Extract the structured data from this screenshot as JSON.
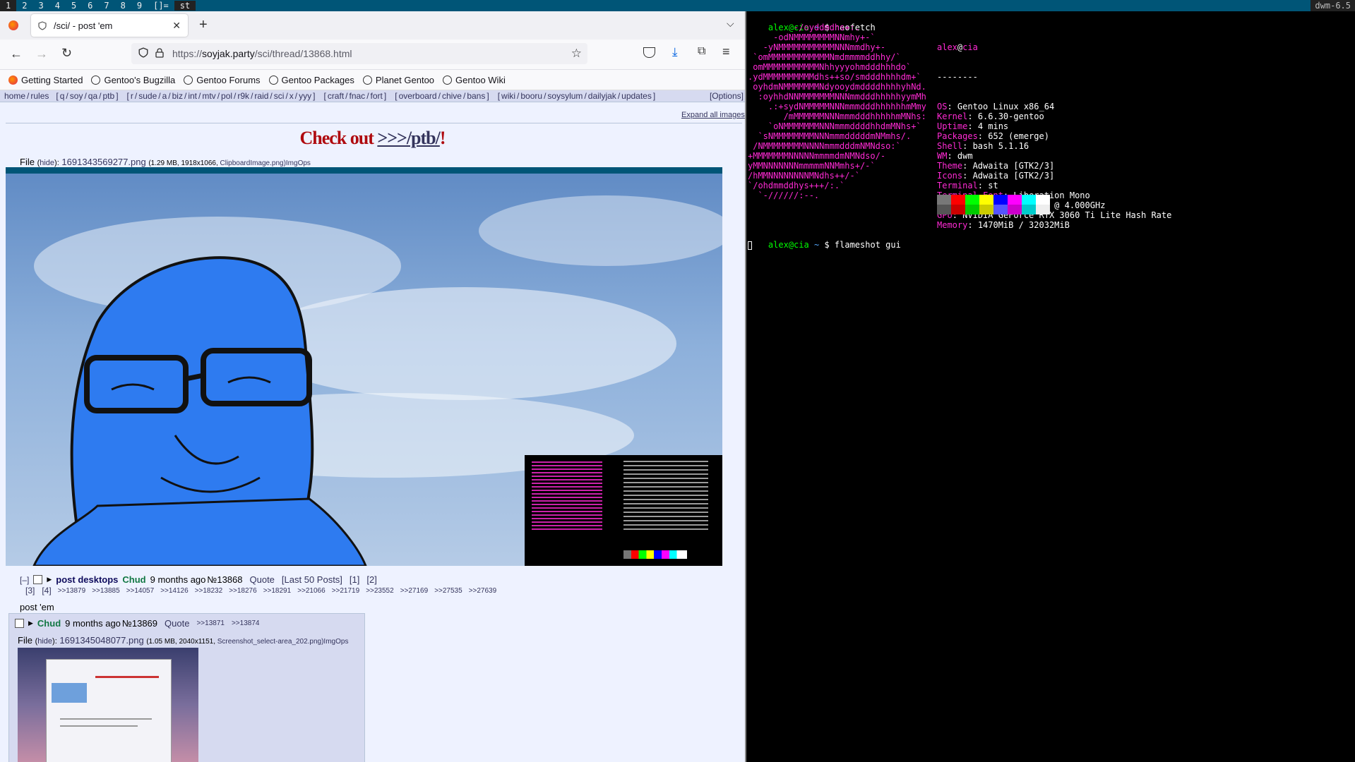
{
  "dwm": {
    "tags": [
      "1",
      "2",
      "3",
      "4",
      "5",
      "6",
      "7",
      "8",
      "9"
    ],
    "layout": "[]=",
    "window_title": "st",
    "status": "dwm-6.5"
  },
  "firefox": {
    "tab_title": "/sci/ - post 'em",
    "url_prefix": "https://",
    "url_domain": "soyjak.party",
    "url_path": "/sci/thread/13868.html",
    "bookmarks": [
      "Getting Started",
      "Gentoo's Bugzilla",
      "Gentoo Forums",
      "Gentoo Packages",
      "Planet Gentoo",
      "Gentoo Wiki"
    ]
  },
  "board": {
    "nav_groups": [
      [
        "home",
        "rules"
      ],
      [
        "q",
        "soy",
        "qa",
        "ptb"
      ],
      [
        "r",
        "sude",
        "a",
        "biz",
        "int",
        "mtv",
        "pol",
        "r9k",
        "raid",
        "sci",
        "x",
        "yyy"
      ],
      [
        "craft",
        "fnac",
        "fort"
      ],
      [
        "overboard",
        "chive",
        "bans"
      ],
      [
        "wiki",
        "booru",
        "soysylum",
        "dailyjak",
        "updates"
      ]
    ],
    "options": "[Options]",
    "expand_all": "Expand all images",
    "banner_prefix": "Check out ",
    "banner_link": ">>>/ptb/",
    "banner_suffix": "!",
    "op": {
      "file_label": "File",
      "hide": "hide",
      "filename": "1691343569277.png",
      "fileinfo": "(1.29 MB, 1918x1066, ",
      "origname": "ClipboardImage.png",
      "imgops": ")ImgOps",
      "minimize": "[–]",
      "subject": "post desktops",
      "name": "Chud",
      "time": "9 months ago",
      "no": "№13868",
      "quote": "Quote",
      "last50": "[Last 50 Posts]",
      "pages": [
        "[1]",
        "[2]",
        "[3]",
        "[4]"
      ],
      "replies": [
        ">>13879",
        ">>13885",
        ">>14057",
        ">>14126",
        ">>18232",
        ">>18276",
        ">>18291",
        ">>21066",
        ">>21719",
        ">>23552",
        ">>27169",
        ">>27535",
        ">>27639"
      ],
      "body": "post 'em"
    },
    "reply": {
      "name": "Chud",
      "time": "9 months ago",
      "no": "№13869",
      "quote": "Quote",
      "backlinks": [
        ">>13871",
        ">>13874"
      ],
      "file_label": "File",
      "hide": "hide",
      "filename": "1691345048077.png",
      "fileinfo": "(1.05 MB, 2040x1151, ",
      "origname": "Screenshot_select-area_202",
      "imgops": ".png)ImgOps"
    }
  },
  "terminal": {
    "user": "alex",
    "host": "cia",
    "prompt1_cmd": "neofetch",
    "prompt2_cmd": "flameshot gui",
    "ascii": [
      "         -/oyddmdhs+:.",
      "     -odNMMMMMMMMNNmhy+-`",
      "   -yNMMMMMMMMMMMNNNmmdhy+-",
      " `omMMMMMMMMMMMMNmdmmmmddhhy/`",
      " omMMMMMMMMMMMNhhyyyohmdddhhhdo`",
      ".ydMMMMMMMMMMdhs++so/smdddhhhhdm+`",
      " oyhdmNMMMMMMMNdyooydmddddhhhhyhNd.",
      "  :oyhhdNNMMMMMMMNNNmmdddhhhhhyymMh",
      "    .:+sydNMMMMMNNNmmmdddhhhhhhmMmy",
      "       /mMMMMMMNNNmmmdddhhhhhmMNhs:",
      "    `oNMMMMMMMNNNmmmddddhhdmMNhs+`",
      "  `sNMMMMMMMMNNNmmmdddddmNMmhs/.",
      " /NMMMMMMMMNNNNmmmdddmNMNdso:`",
      "+MMMMMMMNNNNNmmmmdmNMNdso/-",
      "yMMNNNNNNNmmmmmNNMmhs+/-`",
      "/hMMNNNNNNNNMNdhs++/-`",
      "`/ohdmmddhys+++/:.`",
      "  `-//////:--."
    ],
    "info": [
      {
        "k": "OS",
        "v": "Gentoo Linux x86_64"
      },
      {
        "k": "Kernel",
        "v": "6.6.30-gentoo"
      },
      {
        "k": "Uptime",
        "v": "4 mins"
      },
      {
        "k": "Packages",
        "v": "652 (emerge)"
      },
      {
        "k": "Shell",
        "v": "bash 5.1.16"
      },
      {
        "k": "WM",
        "v": "dwm"
      },
      {
        "k": "Theme",
        "v": "Adwaita [GTK2/3]"
      },
      {
        "k": "Icons",
        "v": "Adwaita [GTK2/3]"
      },
      {
        "k": "Terminal",
        "v": "st"
      },
      {
        "k": "Terminal Font",
        "v": "Liberation Mono"
      },
      {
        "k": "CPU",
        "v": "Intel i5-8400 (6) @ 4.000GHz"
      },
      {
        "k": "GPU",
        "v": "NVIDIA GeForce RTX 3060 Ti Lite Hash Rate"
      },
      {
        "k": "Memory",
        "v": "1470MiB / 32032MiB"
      }
    ],
    "separator": "--------",
    "palette_top": [
      "#777777",
      "#ff0000",
      "#00ff00",
      "#ffff00",
      "#0000ff",
      "#ff00ff",
      "#00ffff",
      "#ffffff"
    ],
    "palette_bottom": [
      "#555555",
      "#cc0000",
      "#00cc00",
      "#cccc00",
      "#5555ff",
      "#cc00cc",
      "#00cccc",
      "#eeeeee"
    ]
  },
  "colors": {
    "dwm_bar": "#005577",
    "board_bg": "#eef2ff",
    "banner_red": "#af0a0f",
    "reply_bg": "#d6daf0",
    "terminal_magenta": "#ff2ad4",
    "soyjak_blue": "#2e7bf0"
  }
}
